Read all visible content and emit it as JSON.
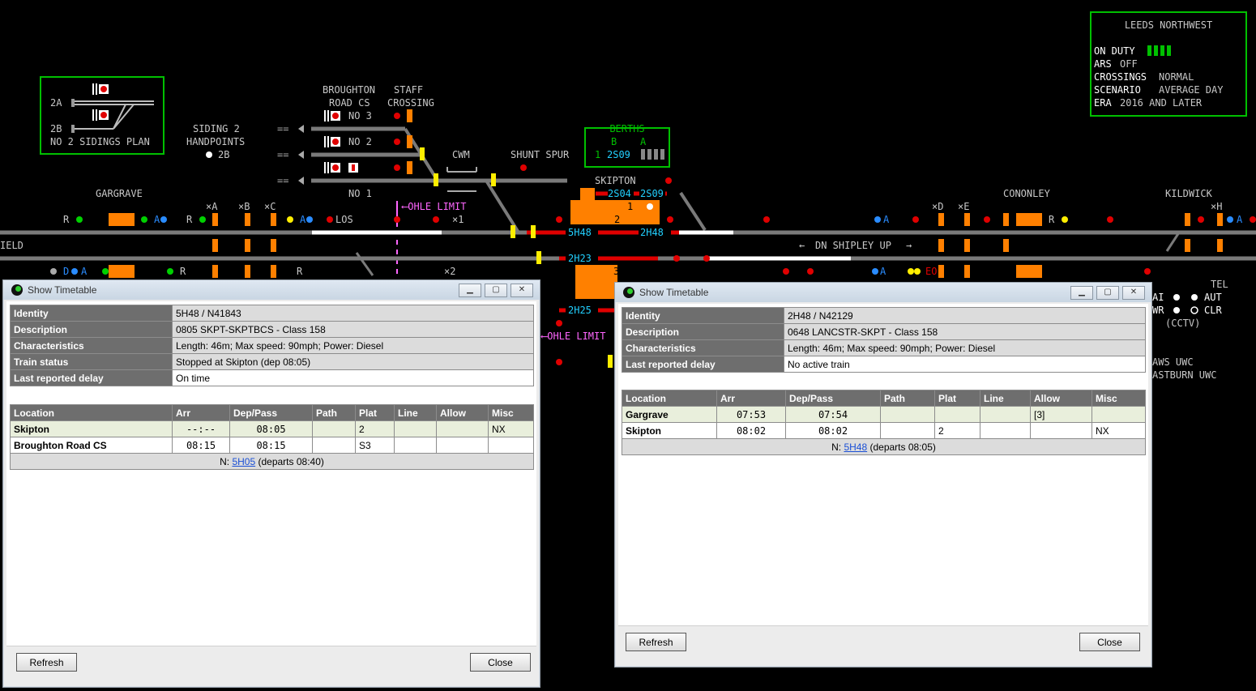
{
  "panel": {
    "info_box": {
      "title": "LEEDS NORTHWEST",
      "rows": [
        {
          "label": "ON DUTY",
          "value": ""
        },
        {
          "label": "ARS",
          "value": "OFF"
        },
        {
          "label": "CROSSINGS",
          "value": "NORMAL"
        },
        {
          "label": "SCENARIO",
          "value": "AVERAGE DAY"
        },
        {
          "label": "ERA",
          "value": "2016 AND LATER"
        }
      ]
    },
    "sidings_box": {
      "label_2a": "2A",
      "label_2b": "2B",
      "caption": "NO 2 SIDINGS PLAN"
    },
    "berths_box": {
      "title": "BERTHS",
      "col_b": "B",
      "col_a": "A",
      "row_no": "1",
      "berth": "2S09"
    },
    "labels": {
      "broughton": "BROUGHTON",
      "road_cs": "ROAD CS",
      "staff": "STAFF",
      "crossing": "CROSSING",
      "no3": "NO 3",
      "no2": "NO 2",
      "no1": "NO 1",
      "siding2": "SIDING 2",
      "handpoints": "HANDPOINTS",
      "hp_2b": "2B",
      "gargrave": "GARGRAVE",
      "cwm": "CWM",
      "shunt_spur": "SHUNT SPUR",
      "skipton": "SKIPTON",
      "cononley": "CONONLEY",
      "kildwick": "KILDWICK",
      "ohle_limit": "OHLE LIMIT",
      "ohle_limit_2": "OHLE LIMIT",
      "los": "LOS",
      "dn_shipley_up": "DN SHIPLEY UP",
      "ield": "IELD",
      "plat1": "1",
      "plat2": "2",
      "plat3": "3",
      "xa": "×A",
      "xb": "×B",
      "xc": "×C",
      "xd": "×D",
      "xe": "×E",
      "xh": "×H",
      "x1": "×1",
      "x2": "×2",
      "r": "R",
      "a": "A",
      "d": "D",
      "eo": "EO",
      "tel": "TEL",
      "ai": "AI",
      "aut": "AUT",
      "wr": "WR",
      "clr": "CLR",
      "cctv": "(CCTV)",
      "aws_uwc": "AWS UWC",
      "eastburn_uwc": "ASTBURN UWC"
    },
    "train_descriptions": {
      "t1": "2S04",
      "t2": "2S09",
      "t3": "5H48",
      "t4": "2H48",
      "t5": "2H23",
      "t6": "2H25"
    }
  },
  "window1": {
    "title": "Show Timetable",
    "details": [
      {
        "key": "Identity",
        "value": "5H48 / N41843"
      },
      {
        "key": "Description",
        "value": "0805 SKPT-SKPTBCS - Class 158"
      },
      {
        "key": "Characteristics",
        "value": "Length: 46m; Max speed: 90mph; Power: Diesel"
      },
      {
        "key": "Train status",
        "value": "Stopped at Skipton (dep 08:05)"
      },
      {
        "key": "Last reported delay",
        "value": "On time"
      }
    ],
    "columns": [
      "Location",
      "Arr",
      "Dep/Pass",
      "Path",
      "Plat",
      "Line",
      "Allow",
      "Misc"
    ],
    "rows": [
      [
        "Skipton",
        "--:--",
        "08:05",
        "",
        "2",
        "",
        "",
        "NX"
      ],
      [
        "Broughton Road CS",
        "08:15",
        "08:15",
        "",
        "S3",
        "",
        "",
        ""
      ]
    ],
    "footer": {
      "prefix": "N:",
      "link": "5H05",
      "suffix": "(departs 08:40)"
    },
    "refresh": "Refresh",
    "close": "Close"
  },
  "window2": {
    "title": "Show Timetable",
    "details": [
      {
        "key": "Identity",
        "value": "2H48 / N42129"
      },
      {
        "key": "Description",
        "value": "0648 LANCSTR-SKPT - Class 158"
      },
      {
        "key": "Characteristics",
        "value": "Length: 46m; Max speed: 90mph; Power: Diesel"
      },
      {
        "key": "Last reported delay",
        "value": "No active train"
      }
    ],
    "columns": [
      "Location",
      "Arr",
      "Dep/Pass",
      "Path",
      "Plat",
      "Line",
      "Allow",
      "Misc"
    ],
    "rows": [
      [
        "Gargrave",
        "07:53",
        "07:54",
        "",
        "",
        "",
        "[3]",
        ""
      ],
      [
        "Skipton",
        "08:02",
        "08:02",
        "",
        "2",
        "",
        "",
        "NX"
      ]
    ],
    "footer": {
      "prefix": "N:",
      "link": "5H48",
      "suffix": "(departs 08:05)"
    },
    "refresh": "Refresh",
    "close": "Close"
  },
  "colors": {
    "track": "#7a7a7a",
    "route": "#ffffff",
    "track_circuit_red": "#e00000",
    "platform": "#ff8000",
    "text": "#c8c8c8",
    "berth_text": "#22d0ff",
    "box_green": "#00c000",
    "ohle": "#ff66ff"
  }
}
